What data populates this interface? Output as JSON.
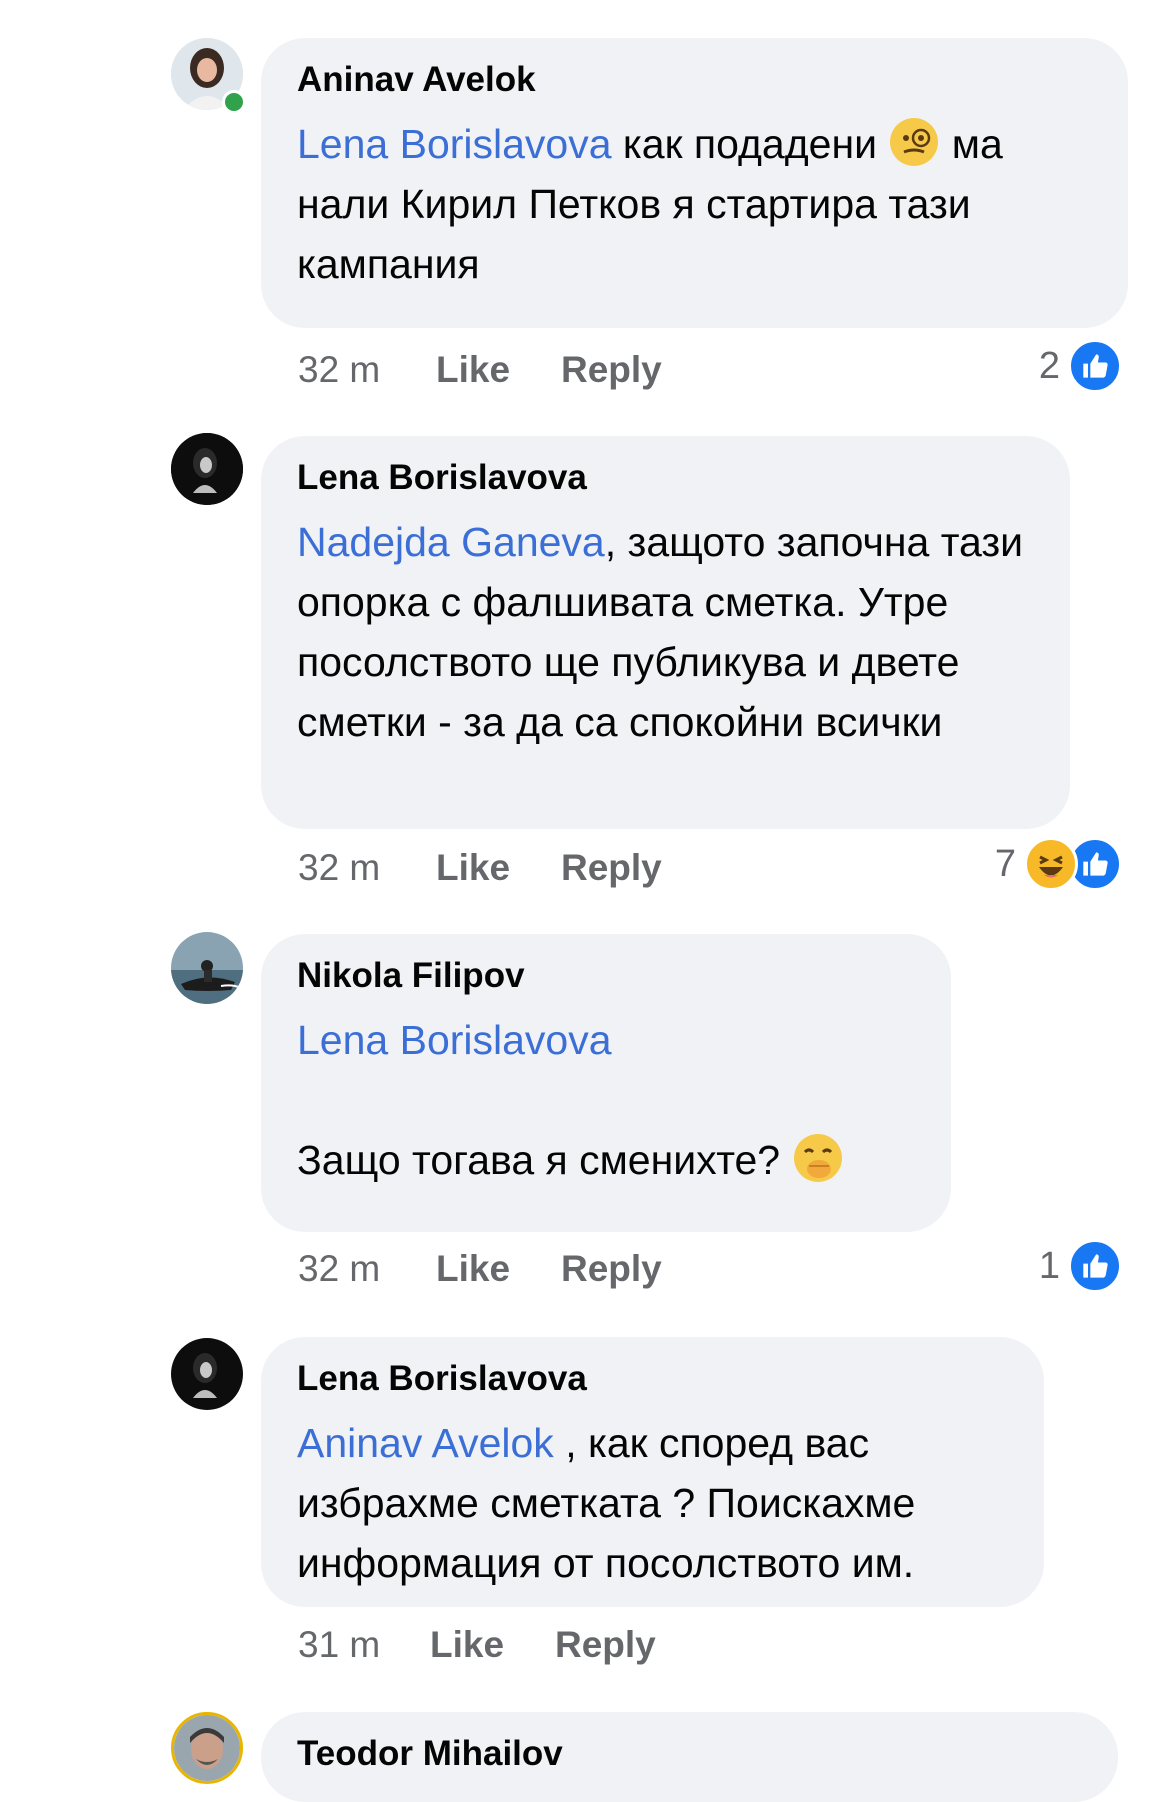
{
  "comments": [
    {
      "author": "Aninav Avelok",
      "mention": "Lena Borislavova",
      "text_line1": " как подадени ",
      "emoji_1": "monocle-face-emoji",
      "text_line1b": " ма",
      "text_rest": "нали Кирил Петков я стартира тази кампания",
      "time": "32 m",
      "like_label": "Like",
      "reply_label": "Reply",
      "reaction_count": "2"
    },
    {
      "author": "Lena Borislavova",
      "mention": "Nadejda Ganeva",
      "text": ", защото започна тази опорка с фалшивата сметка. Утре посолството ще публикува и двете сметки - за да са спокойни всички",
      "time": "32 m",
      "like_label": "Like",
      "reply_label": "Reply",
      "reaction_count": "7"
    },
    {
      "author": "Nikola Filipov",
      "mention": "Lena Borislavova",
      "text": "Защо тогава я сменихте? ",
      "emoji": "face-with-hand-over-mouth-emoji",
      "time": "32 m",
      "like_label": "Like",
      "reply_label": "Reply",
      "reaction_count": "1"
    },
    {
      "author": "Lena Borislavova",
      "mention": "Aninav Avelok",
      "text": " , как според вас избрахме сметката ? Поискахме информация от посолството им.",
      "time": "31 m",
      "like_label": "Like",
      "reply_label": "Reply"
    },
    {
      "author": "Teodor Mihailov"
    }
  ],
  "colors": {
    "bubble": "#f0f2f5",
    "mention": "#3b6fd6",
    "meta": "#65676b",
    "like": "#1877f2",
    "haha": "#f7b928",
    "online": "#31a24c"
  }
}
